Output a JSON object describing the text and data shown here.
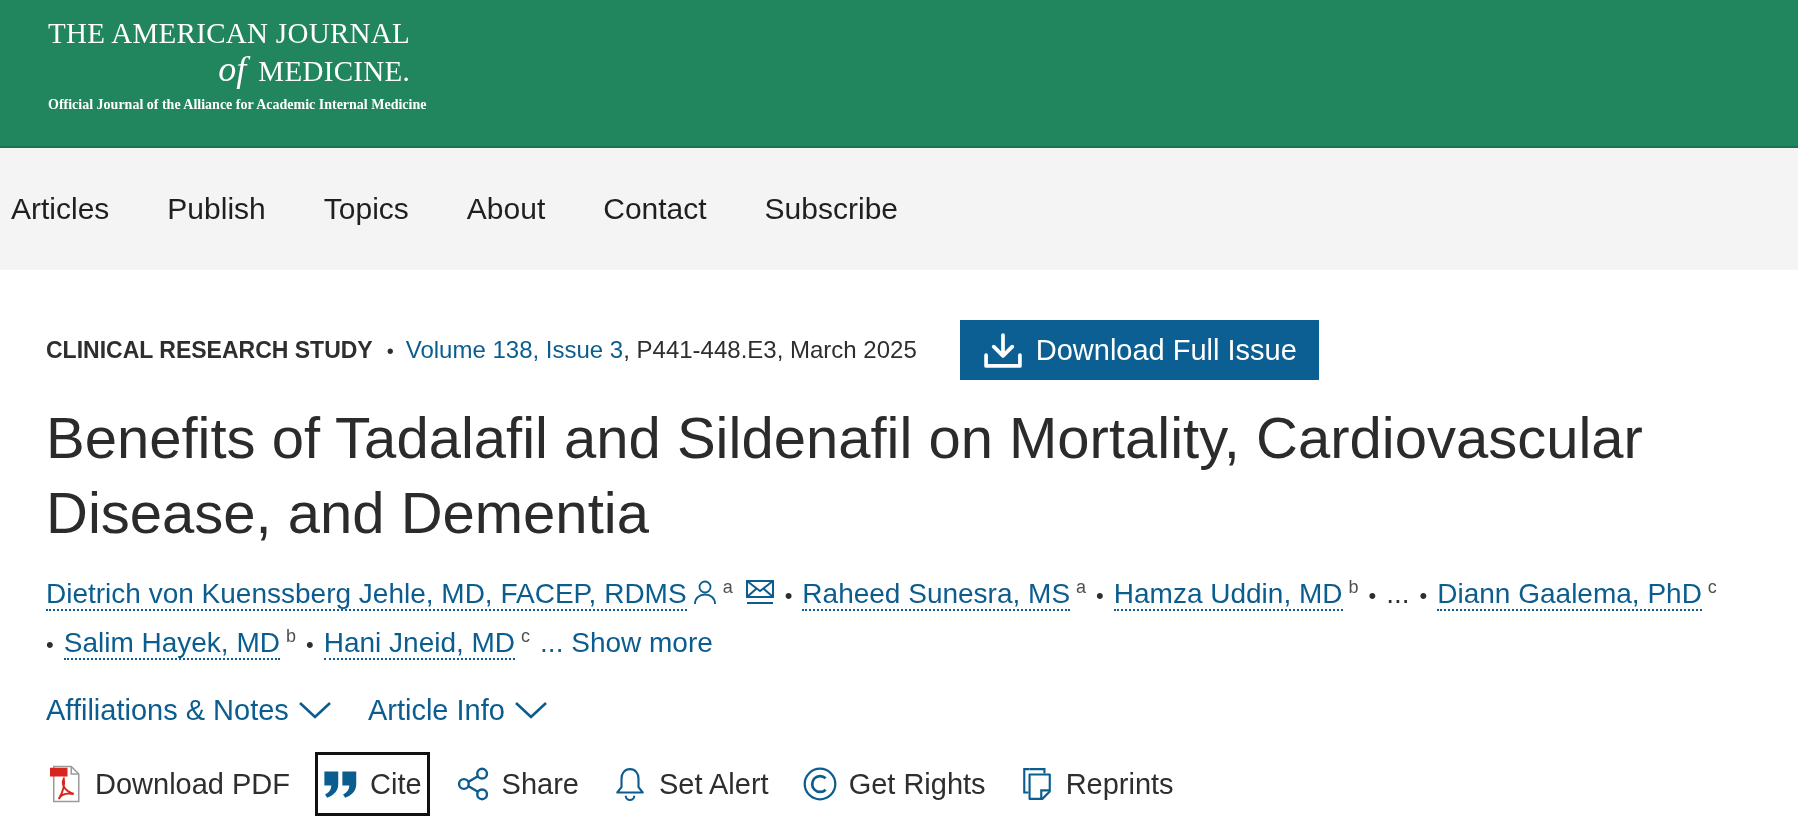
{
  "header": {
    "logo": {
      "title_line": "THE AMERICAN JOURNAL",
      "of": "of",
      "name": "MEDICINE.",
      "tagline": "Official Journal of the Alliance for Academic Internal Medicine"
    }
  },
  "nav": {
    "items": [
      {
        "label": "Articles"
      },
      {
        "label": "Publish"
      },
      {
        "label": "Topics"
      },
      {
        "label": "About"
      },
      {
        "label": "Contact"
      },
      {
        "label": "Subscribe"
      }
    ]
  },
  "article": {
    "meta": {
      "type": "CLINICAL RESEARCH STUDY",
      "separator": "•",
      "issue_link": "Volume 138, Issue 3",
      "details": ", P441-448.E3, March 2025"
    },
    "download_button": {
      "label": "Download Full Issue"
    },
    "title": "Benefits of Tadalafil and Sildenafil on Mortality, Cardiovascular Disease, and Dementia",
    "authors": [
      {
        "kind": "author",
        "name": "Dietrich von Kuenssberg Jehle, MD, FACEP, RDMS",
        "profile": true,
        "affiliation": "a",
        "email": true
      },
      {
        "kind": "author",
        "separator": "•",
        "name": "Raheed Sunesra, MS",
        "affiliation": "a"
      },
      {
        "kind": "author",
        "separator": "•",
        "name": "Hamza Uddin, MD",
        "affiliation": "b"
      },
      {
        "kind": "ellipsis",
        "separator": "•",
        "text": "..."
      },
      {
        "kind": "author",
        "separator": "•",
        "name": "Diann Gaalema, PhD",
        "affiliation": "c"
      },
      {
        "kind": "author",
        "separator": "•",
        "name": "Salim Hayek, MD",
        "affiliation": "b"
      },
      {
        "kind": "author",
        "separator": "•",
        "name": "Hani Jneid, MD",
        "affiliation": "c"
      }
    ],
    "show_more": "... Show more",
    "toggles": [
      {
        "label": "Affiliations & Notes",
        "expanded": false
      },
      {
        "label": "Article Info",
        "expanded": false
      }
    ],
    "actions": [
      {
        "kind": "pdf",
        "label": "Download PDF",
        "focused": false
      },
      {
        "kind": "cite",
        "label": "Cite",
        "focused": true
      },
      {
        "kind": "share",
        "label": "Share",
        "focused": false
      },
      {
        "kind": "alert",
        "label": "Set Alert",
        "focused": false
      },
      {
        "kind": "rights",
        "label": "Get Rights",
        "focused": false
      },
      {
        "kind": "reprints",
        "label": "Reprints",
        "focused": false
      }
    ]
  }
}
